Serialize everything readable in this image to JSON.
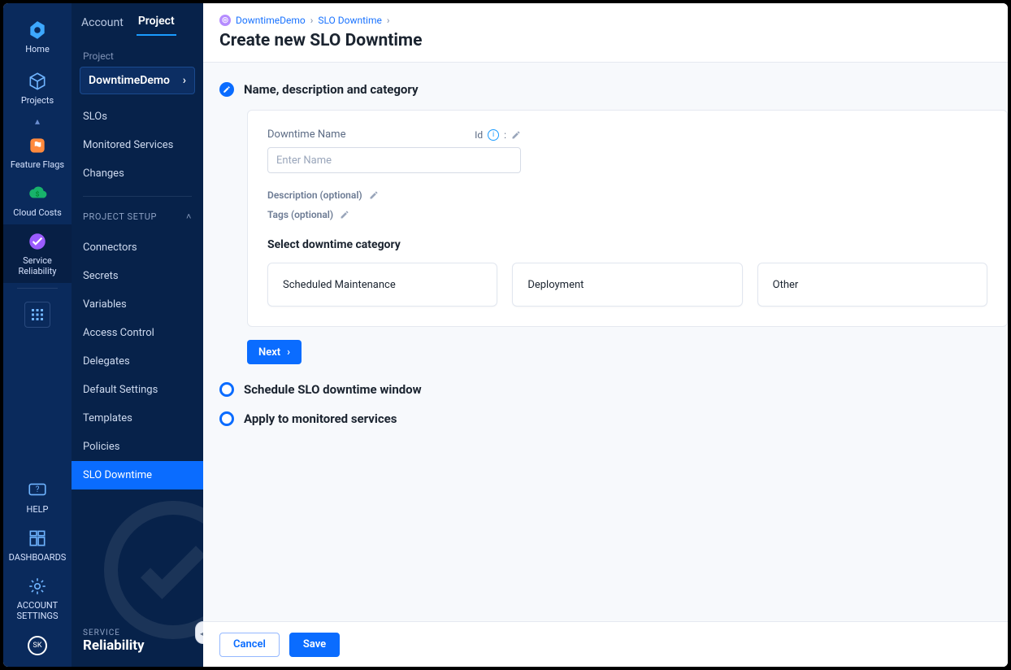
{
  "rail": {
    "home": "Home",
    "projects": "Projects",
    "feature_flags": "Feature Flags",
    "cloud_costs": "Cloud Costs",
    "service_reliability": "Service\nReliability",
    "help": "HELP",
    "dashboards": "DASHBOARDS",
    "account_settings": "ACCOUNT\nSETTINGS",
    "avatar_initials": "SK"
  },
  "sidebar": {
    "tabs": {
      "account": "Account",
      "project": "Project"
    },
    "project_label": "Project",
    "project_name": "DowntimeDemo",
    "items": [
      "SLOs",
      "Monitored Services",
      "Changes"
    ],
    "setup_header": "PROJECT SETUP",
    "setup_items": [
      "Connectors",
      "Secrets",
      "Variables",
      "Access Control",
      "Delegates",
      "Default Settings",
      "Templates",
      "Policies",
      "SLO Downtime"
    ],
    "service_tag": "SERVICE",
    "service_name": "Reliability"
  },
  "breadcrumbs": {
    "root": "DowntimeDemo",
    "page": "SLO Downtime"
  },
  "page_title": "Create new SLO Downtime",
  "form": {
    "step1_title": "Name, description and category",
    "name_label": "Downtime Name",
    "id_label": "Id",
    "id_colon": ":",
    "name_placeholder": "Enter Name",
    "description_label": "Description (optional)",
    "tags_label": "Tags (optional)",
    "category_title": "Select downtime category",
    "categories": [
      "Scheduled Maintenance",
      "Deployment",
      "Other"
    ],
    "next": "Next",
    "step2_title": "Schedule SLO downtime window",
    "step3_title": "Apply to monitored services"
  },
  "footer": {
    "cancel": "Cancel",
    "save": "Save"
  }
}
